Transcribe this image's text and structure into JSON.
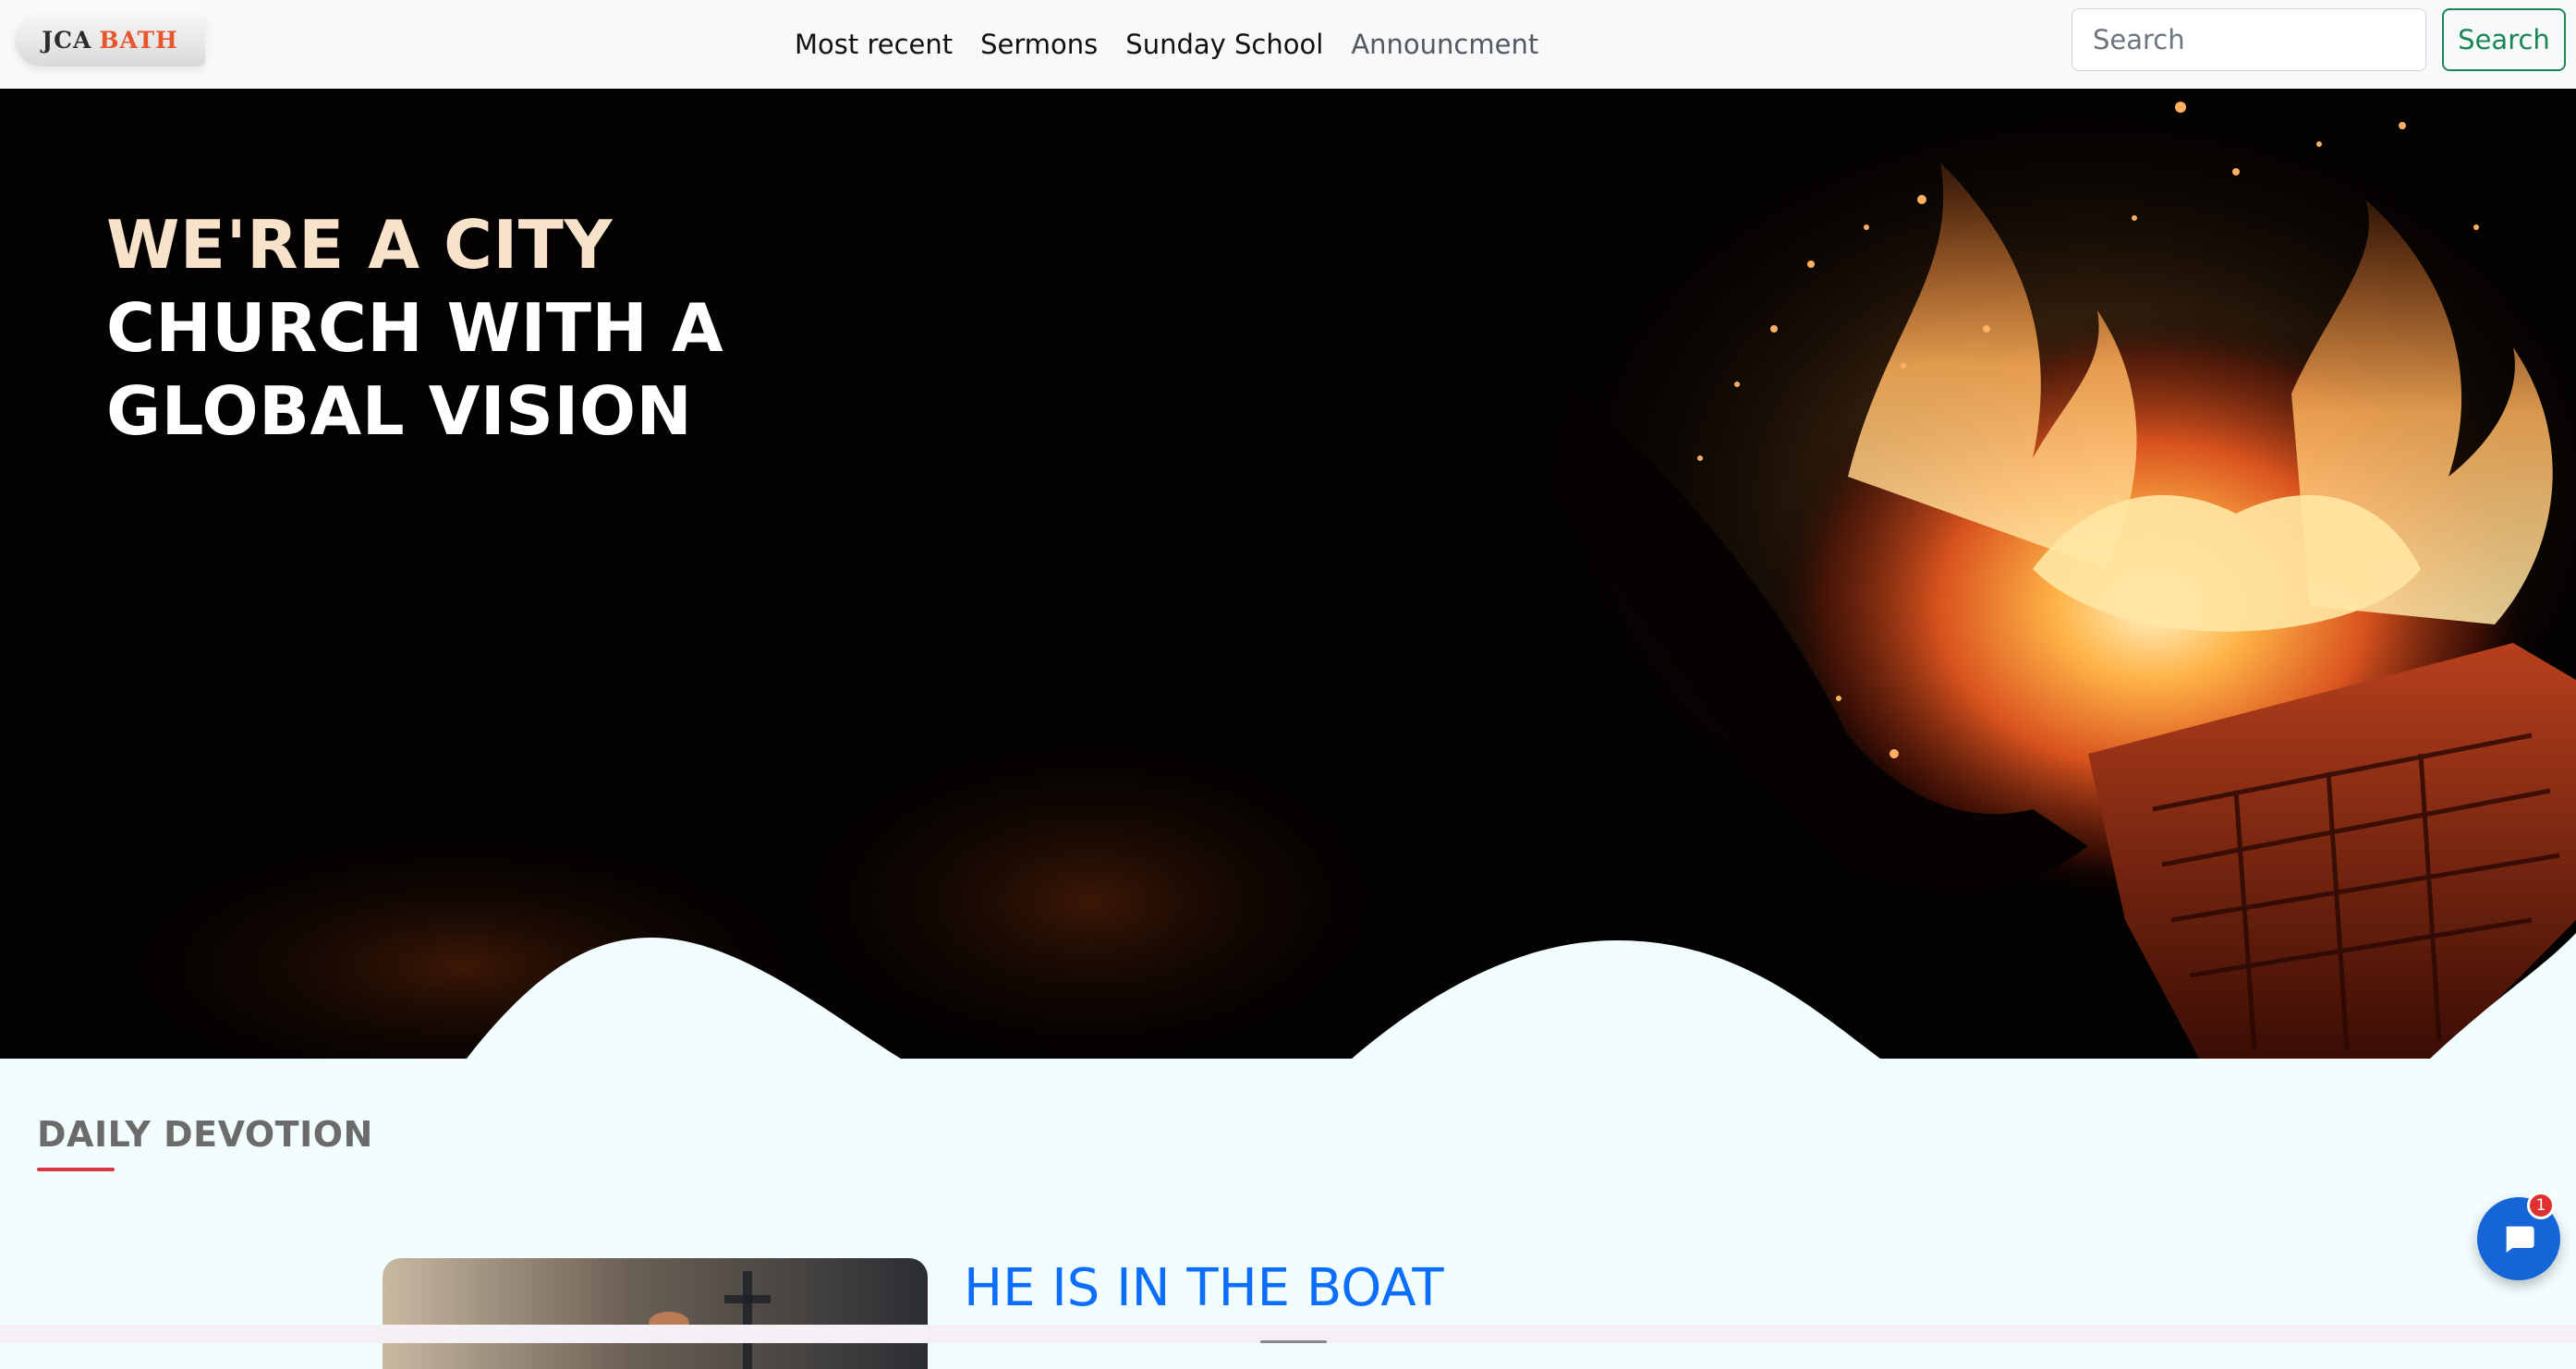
{
  "brand": {
    "part1": "JCA",
    "part2": "BATH"
  },
  "nav": {
    "links": [
      {
        "label": "Most recent"
      },
      {
        "label": "Sermons"
      },
      {
        "label": "Sunday School"
      },
      {
        "label": "Announcment"
      }
    ]
  },
  "search": {
    "placeholder": "Search",
    "button_label": "Search"
  },
  "hero": {
    "lines": [
      "WE'RE A CITY",
      "CHURCH WITH A",
      "GLOBAL VISION"
    ]
  },
  "devotion": {
    "section_title": "DAILY DEVOTION",
    "heading": "HE IS IN THE BOAT"
  },
  "chat": {
    "badge_count": "1",
    "icon": "chat-bubble-icon"
  },
  "colors": {
    "accent_green": "#198754",
    "accent_blue": "#0d6efd",
    "brand_orange": "#e8562d",
    "underline_red": "#dc3545",
    "chat_blue": "#1565d8"
  }
}
